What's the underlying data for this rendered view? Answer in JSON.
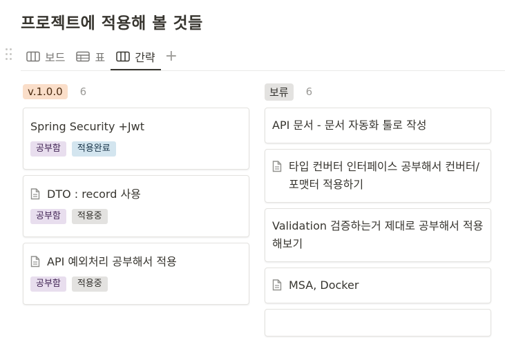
{
  "page": {
    "title": "프로젝트에 적용해 볼 것들"
  },
  "tabs": [
    {
      "label": "보드",
      "icon": "board-icon"
    },
    {
      "label": "표",
      "icon": "table-icon"
    },
    {
      "label": "간략",
      "icon": "board-icon",
      "active": true
    }
  ],
  "add_view_label": "+",
  "colors": {
    "purple_bg": "#e8deee",
    "blue_bg": "#d3e5ef",
    "gray_bg": "#e3e2e0",
    "orange_bg": "#fadec9",
    "text_gray": "#9b9a97"
  },
  "columns": [
    {
      "group": "v.1.0.0",
      "count": "6",
      "cards": [
        {
          "title": "Spring Security +Jwt",
          "tags": [
            "공부함",
            "적용완료"
          ]
        },
        {
          "title": "DTO : record  사용",
          "tags": [
            "공부함",
            "적용중"
          ]
        },
        {
          "title": "API 예외처리 공부해서 적용",
          "tags": [
            "공부함",
            "적용중"
          ]
        }
      ]
    },
    {
      "group": "보류",
      "count": "6",
      "cards": [
        {
          "title": "API 문서 - 문서 자동화 툴로 작성"
        },
        {
          "title": "타입 컨버터 인터페이스 공부해서 컨버터/포맷터 적용하기"
        },
        {
          "title": "Validation 검증하는거 제대로 공부해서 적용해보기"
        },
        {
          "title": "MSA, Docker"
        }
      ]
    }
  ]
}
